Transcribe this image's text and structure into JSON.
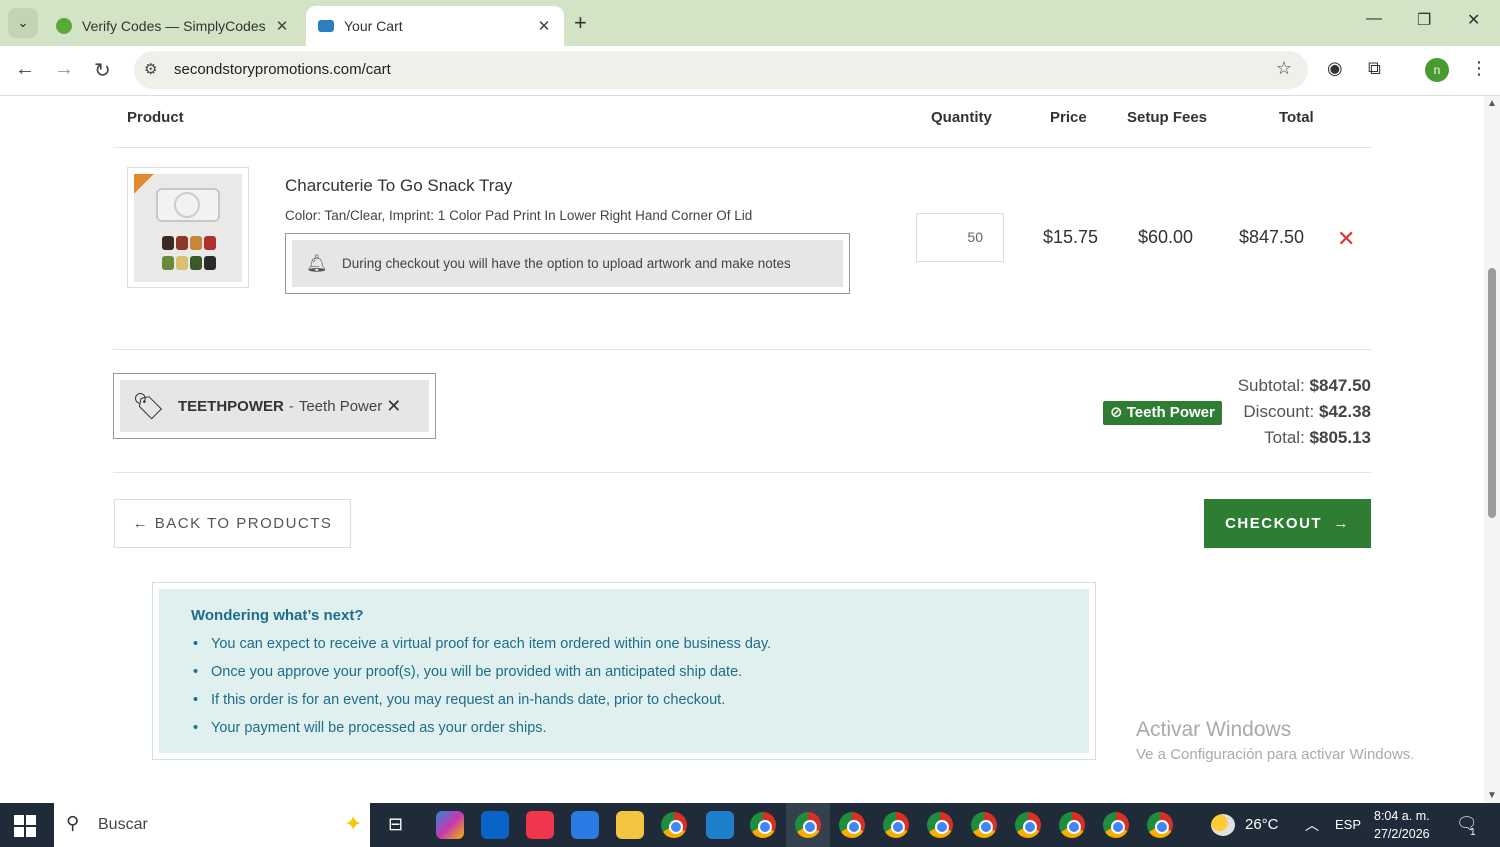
{
  "browser": {
    "tabs": [
      {
        "title": "Verify Codes — SimplyCodes",
        "active": false
      },
      {
        "title": "Your Cart",
        "active": true
      }
    ],
    "url": "secondstorypromotions.com/cart",
    "profile_initial": "n"
  },
  "cart": {
    "headers": {
      "product": "Product",
      "quantity": "Quantity",
      "price": "Price",
      "setup_fees": "Setup Fees",
      "total": "Total"
    },
    "item": {
      "name": "Charcuterie To Go Snack Tray",
      "description": "Color: Tan/Clear, Imprint: 1 Color Pad Print In Lower Right Hand Corner Of Lid",
      "note": "During checkout you will have the option to upload artwork and make notes",
      "quantity": "50",
      "price": "$15.75",
      "setup_fees": "$60.00",
      "total": "$847.50"
    },
    "coupon": {
      "code": "TEETHPOWER",
      "separator": "-",
      "name": "Teeth Power"
    },
    "summary": {
      "subtotal_label": "Subtotal:",
      "subtotal": "$847.50",
      "discount_badge": "Teeth Power",
      "discount_label": "Discount:",
      "discount": "$42.38",
      "total_label": "Total:",
      "total": "$805.13"
    },
    "back_button": "BACK TO PRODUCTS",
    "checkout_button": "CHECKOUT",
    "next": {
      "heading": "Wondering what’s next?",
      "items": [
        "You can expect to receive a virtual proof for each item ordered within one business day.",
        "Once you approve your proof(s), you will be provided with an anticipated ship date.",
        "If this order is for an event, you may request an in-hands date, prior to checkout.",
        "Your payment will be processed as your order ships."
      ]
    }
  },
  "watermark": {
    "title": "Activar Windows",
    "subtitle": "Ve a Configuración para activar Windows."
  },
  "taskbar": {
    "search_placeholder": "Buscar",
    "weather": "26°C",
    "language": "ESP",
    "time": "8:04 a. m.",
    "date": "27/2/2026",
    "notifications": "1"
  },
  "colors": {
    "accent_green": "#2e7d32",
    "remove_red": "#dd3333",
    "info_text": "#1f6d8a",
    "info_bg": "#dff0ef"
  }
}
